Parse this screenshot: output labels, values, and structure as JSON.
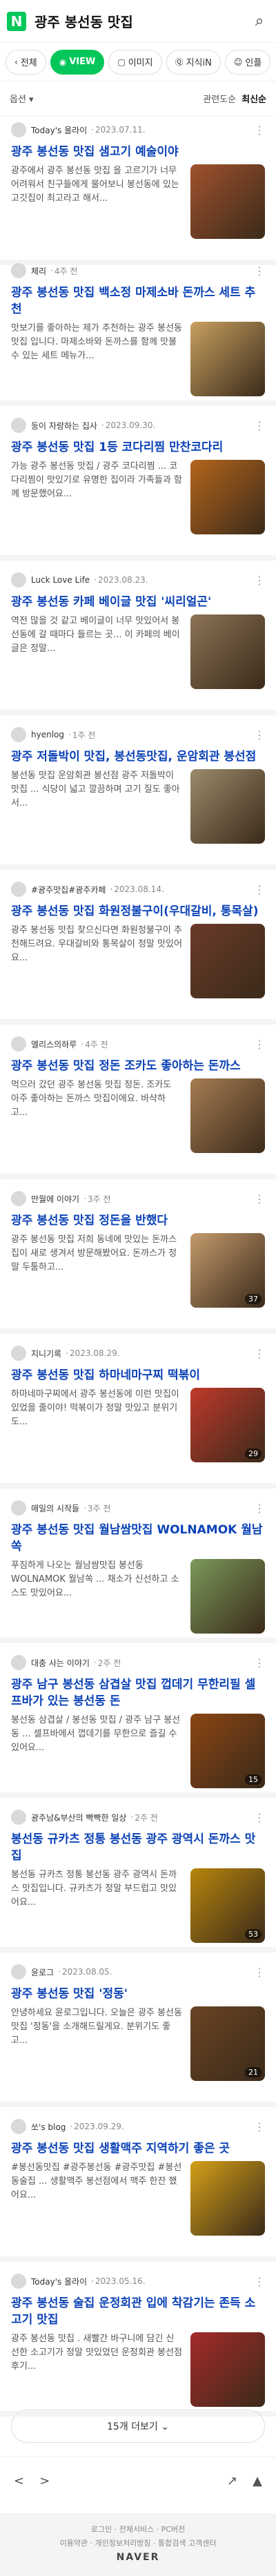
{
  "search": {
    "query": "광주 봉선동 맛집"
  },
  "tabs": [
    {
      "label": "전체"
    },
    {
      "label": "VIEW"
    },
    {
      "label": "이미지"
    },
    {
      "label": "지식iN"
    },
    {
      "label": "인플"
    }
  ],
  "options": {
    "left": "옵션 ▾",
    "sort_relevance": "관련도순",
    "sort_latest": "최신순"
  },
  "posts": [
    {
      "author": "Today's 올라이",
      "date": "2023.07.11.",
      "title": "광주 봉선동 맛집 샘고기 예술이야",
      "snippet": "광주에서 광주 봉선동 맛집 을 고르기가 너무 어려워서 친구들에게 물어보니 봉선동에 있는 고깃집이 최고라고 해서...",
      "photos": "",
      "color": "#a0522d"
    },
    {
      "author": "체리",
      "date": "4주 전",
      "title": "광주 봉선동 맛집 백소정 마제소바 돈까스 세트 추천",
      "snippet": "맛보기를 좋아하는 제가 추천하는 광주 봉선동 맛집 입니다. 마제소바와 돈까스를 함께 맛볼 수 있는 세트 메뉴가...",
      "photos": "",
      "color": "#c8a060"
    },
    {
      "author": "둥이 자랑하는 집사",
      "date": "2023.09.30.",
      "title": "광주 봉선동 맛집 1등 코다리찜 만찬코다리",
      "snippet": "가능 광주 봉선동 맛집 / 광주 코다리찜 ... 코다리찜이 맛있기로 유명한 집이라 가족들과 함께 방문했어요...",
      "photos": "",
      "color": "#b5651d"
    },
    {
      "author": "Luck Love Life",
      "date": "2023.08.23.",
      "title": "광주 봉선동 카페 베이글 맛집 '씨리얼곤'",
      "snippet": "역전 많을 것 같고 베이글이 너무 맛있어서 봉선동에 갈 때마다 들르는 곳... 이 카페의 베이글은 정말...",
      "photos": "",
      "color": "#8b7355"
    },
    {
      "author": "hyenlog",
      "date": "1주 전",
      "title": "광주 저돌박이 맛집, 봉선동맛집, 운암회관 봉선점",
      "snippet": "봉선동 맛집 운암회관 봉선점 광주 저돌박이 맛집 ... 식당이 넓고 깔끔하며 고기 질도 좋아서...",
      "photos": "",
      "color": "#9b8b6b"
    },
    {
      "author": "#광주맛집#광주카페",
      "date": "2023.08.14.",
      "title": "광주 봉선동 맛집 화원정불구이(우대갈비, 통목살)",
      "snippet": "광주 봉선동 맛집 찾으신다면 화원정불구이 추천해드려요. 우대갈비와 통목살이 정말 맛있어요...",
      "photos": "",
      "color": "#6b3a2a"
    },
    {
      "author": "엘리스의하루",
      "date": "4주 전",
      "title": "광주 봉선동 맛집 정돈 조카도 좋아하는 돈까스",
      "snippet": "먹으러 갔던 광주 봉선동 맛집 정돈. 조카도 아주 좋아하는 돈까스 맛집이에요. 바삭하고...",
      "photos": "",
      "color": "#a67c52"
    },
    {
      "author": "만월에 이야기",
      "date": "3주 전",
      "title": "광주 봉선동 맛집 정돈을 반했다",
      "snippet": "광주 봉선동 맛집 저희 동네에 맛있는 돈까스집이 새로 생겨서 방문해봤어요. 돈까스가 정말 두툼하고...",
      "photos": "37",
      "color": "#c49a6c"
    },
    {
      "author": "지니기록",
      "date": "2023.08.29.",
      "title": "광주 봉선동 맛집 하마네마구찌 떡볶이",
      "snippet": "하마네마구찌에서 광주 봉선동에 이런 맛집이 있었을 줄이야! 떡볶이가 정말 맛있고 분위기도...",
      "photos": "29",
      "color": "#c0392b"
    },
    {
      "author": "매일의 시작들",
      "date": "3주 전",
      "title": "광주 봉선동 맛집 월남쌈맛집 WOLNAMOK 월남쏙",
      "snippet": "푸짐하게 나오는 월남쌈맛집 봉선동 WOLNAMOK 월남쏙 ... 채소가 신선하고 소스도 맛있어요...",
      "photos": "",
      "color": "#7a9a5a"
    },
    {
      "author": "대충 사는 이야기",
      "date": "2주 전",
      "title": "광주 남구 봉선동 삼겹살 맛집 껍데기 무한리필 셀프바가 있는 봉선동 돈",
      "snippet": "봉선동 삼겹살 / 봉선동 맛집 / 광주 남구 봉선동 ... 셀프바에서 껍데기를 무한으로 즐길 수 있어요...",
      "photos": "15",
      "color": "#8b4513"
    },
    {
      "author": "광주남&부산의 빡빡한 일상",
      "date": "2주 전",
      "title": "봉선동 규카츠 정통 봉선동 광주 광역시 돈까스 맛집",
      "snippet": "봉선동 규카츠 정통 봉선동 광주 광역시 돈까스 맛집입니다. 규카츠가 정말 부드럽고 맛있어요...",
      "photos": "53",
      "color": "#b8860b"
    },
    {
      "author": "윤로그",
      "date": "2023.08.05.",
      "title": "광주 봉선동 맛집 '정동'",
      "snippet": "안녕하세요 윤로그입니다. 오늘은 광주 봉선동 맛집 '정동'을 소개해드릴게요. 분위기도 좋고...",
      "photos": "21",
      "color": "#6b4423"
    },
    {
      "author": "쏘's blog",
      "date": "2023.09.29.",
      "title": "광주 봉선동 맛집 생활맥주 지역하기 좋은 곳",
      "snippet": "#봉선동맛집 #광주봉선동 #광주맛집 #봉선동술집 ... 생활맥주 봉선점에서 맥주 한잔 했어요...",
      "photos": "",
      "color": "#d4a017"
    },
    {
      "author": "Today's 올라이",
      "date": "2023.05.16.",
      "title": "광주 봉선동 술집 운정회관 입에 착감기는 존득 소고기 맛집",
      "snippet": "광주 봉선동 맛집 . 새빨간 바구니에 담긴 신선한 소고기가 정말 맛있었던 운정회관 봉선점 후기...",
      "photos": "",
      "color": "#a52a2a"
    }
  ],
  "pagination": {
    "label": "15개 더보기 ⌄"
  },
  "bottom": {
    "back": "<",
    "forward": ">",
    "share": "↗",
    "top": "▲"
  },
  "footer": {
    "links1": "로그인 · 전체서비스 · PC버전",
    "links2": "이용약관 · 개인정보처리방침 · 통합검색 고객센터",
    "brand": "NAVER"
  }
}
